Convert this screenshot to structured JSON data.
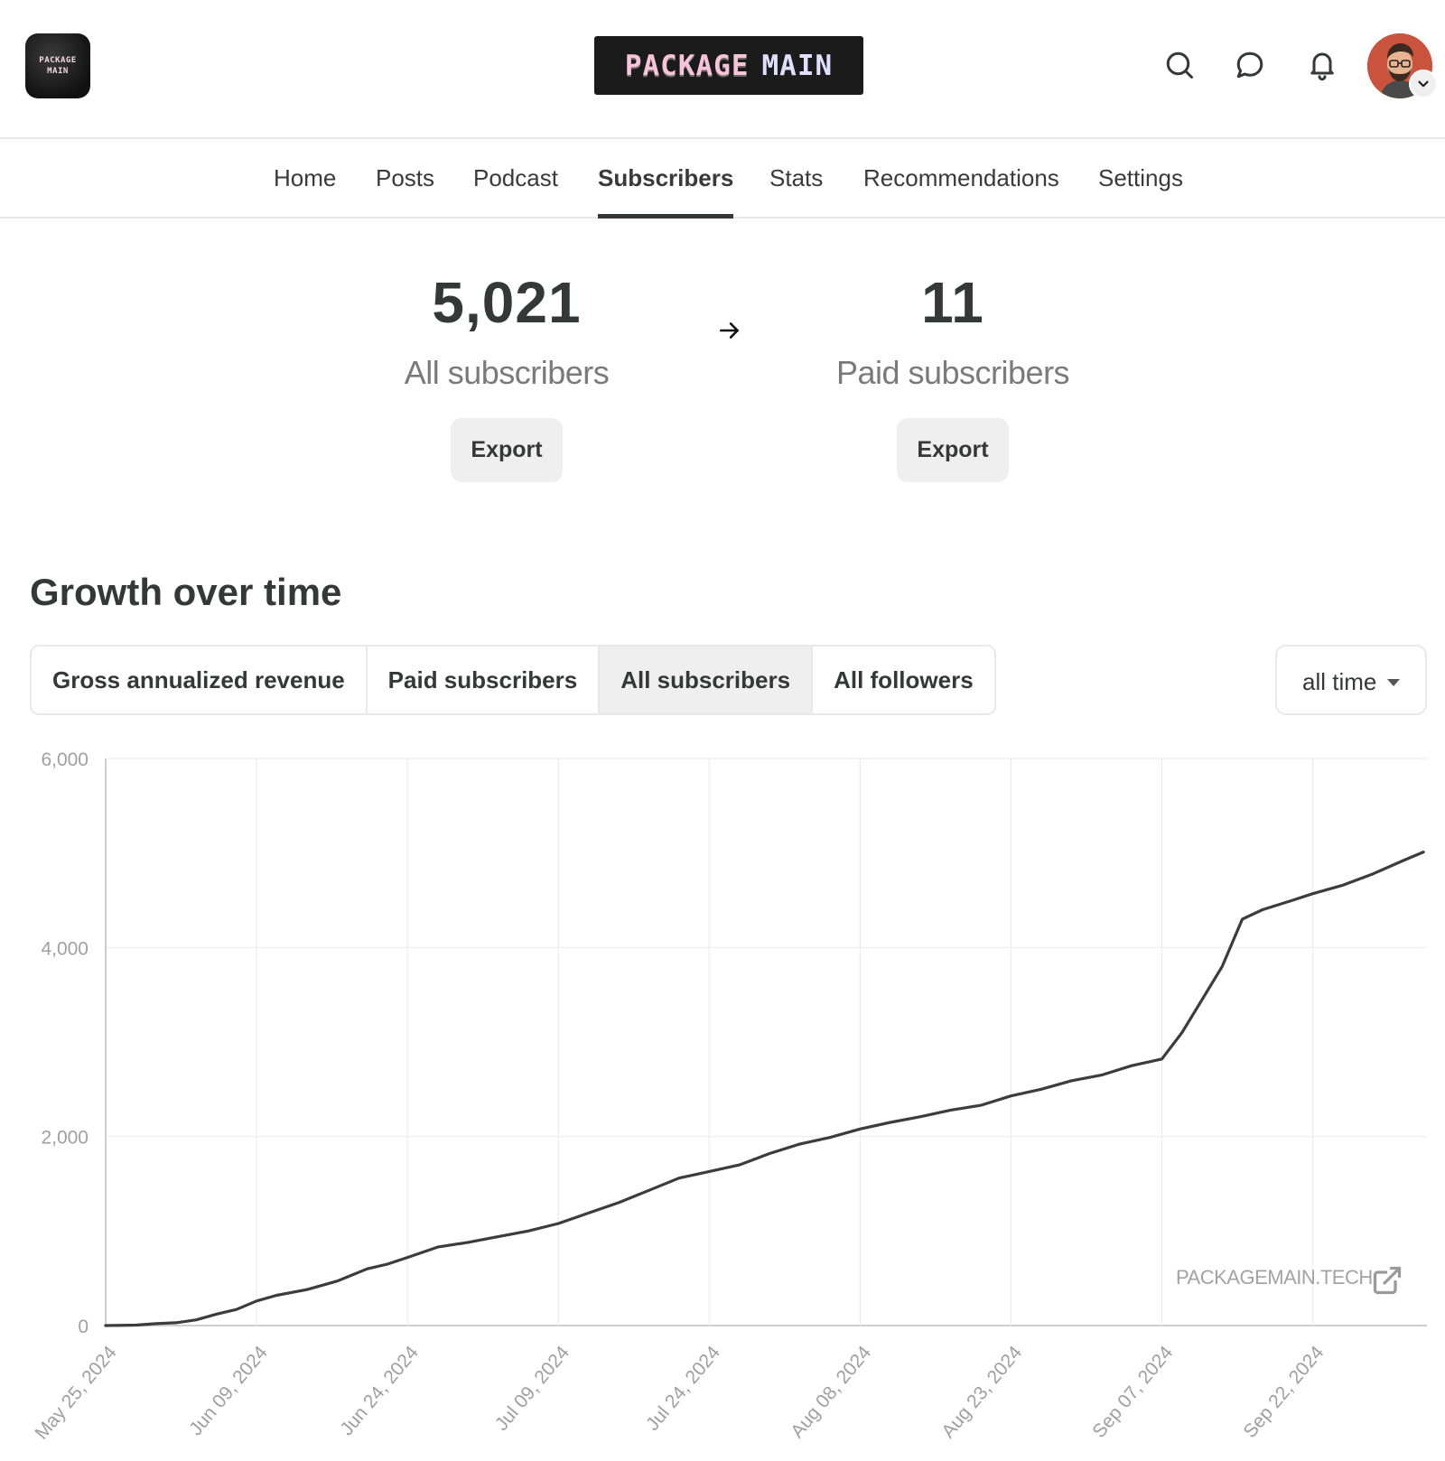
{
  "header": {
    "app_logo_text": [
      "PACKAGE",
      "MAIN"
    ],
    "wordmark": [
      "PACKAGE",
      "MAIN"
    ],
    "icons": [
      "search-icon",
      "chat-icon",
      "bell-icon",
      "avatar",
      "chevron-down-icon"
    ]
  },
  "nav": {
    "tabs": [
      {
        "label": "Home"
      },
      {
        "label": "Posts"
      },
      {
        "label": "Podcast"
      },
      {
        "label": "Subscribers",
        "active": true
      },
      {
        "label": "Stats"
      },
      {
        "label": "Recommendations"
      },
      {
        "label": "Settings"
      }
    ]
  },
  "summary": {
    "all": {
      "value": "5,021",
      "label": "All subscribers",
      "export_label": "Export"
    },
    "paid": {
      "value": "11",
      "label": "Paid subscribers",
      "export_label": "Export"
    }
  },
  "growth": {
    "title": "Growth over time",
    "segments": [
      {
        "label": "Gross annualized revenue"
      },
      {
        "label": "Paid subscribers"
      },
      {
        "label": "All subscribers",
        "active": true
      },
      {
        "label": "All followers"
      }
    ],
    "range": "all time",
    "watermark": "PACKAGEMAIN.TECH"
  },
  "colors": {
    "line": "#3c3c3c",
    "grid": "#ececec",
    "axis": "#cfcfcf",
    "tick": "#a0a0a0"
  },
  "chart_data": {
    "type": "line",
    "title": "",
    "xlabel": "",
    "ylabel": "",
    "ylim": [
      0,
      6000
    ],
    "yticks": [
      "0",
      "2,000",
      "4,000",
      "6,000"
    ],
    "yticks_values": [
      0,
      2000,
      4000,
      6000
    ],
    "xticks": [
      "May 25, 2024",
      "Jun 09, 2024",
      "Jun 24, 2024",
      "Jul 09, 2024",
      "Jul 24, 2024",
      "Aug 08, 2024",
      "Aug 23, 2024",
      "Sep 07, 2024",
      "Sep 22, 2024"
    ],
    "grid": true,
    "series": [
      {
        "x": [
          "2024-05-25",
          "2024-05-28",
          "2024-05-30",
          "2024-06-01",
          "2024-06-03",
          "2024-06-05",
          "2024-06-07",
          "2024-06-09",
          "2024-06-11",
          "2024-06-14",
          "2024-06-17",
          "2024-06-20",
          "2024-06-22",
          "2024-06-24",
          "2024-06-27",
          "2024-06-30",
          "2024-07-03",
          "2024-07-06",
          "2024-07-09",
          "2024-07-12",
          "2024-07-15",
          "2024-07-18",
          "2024-07-21",
          "2024-07-24",
          "2024-07-27",
          "2024-07-30",
          "2024-08-02",
          "2024-08-05",
          "2024-08-08",
          "2024-08-11",
          "2024-08-14",
          "2024-08-17",
          "2024-08-20",
          "2024-08-23",
          "2024-08-26",
          "2024-08-29",
          "2024-09-01",
          "2024-09-04",
          "2024-09-07",
          "2024-09-09",
          "2024-09-11",
          "2024-09-13",
          "2024-09-15",
          "2024-09-17",
          "2024-09-20",
          "2024-09-22",
          "2024-09-25",
          "2024-09-28",
          "2024-10-01",
          "2024-10-03"
        ],
        "y": [
          0,
          5,
          20,
          30,
          60,
          120,
          170,
          260,
          320,
          380,
          470,
          600,
          650,
          720,
          830,
          880,
          940,
          1000,
          1080,
          1190,
          1300,
          1430,
          1560,
          1630,
          1700,
          1820,
          1920,
          1990,
          2080,
          2150,
          2210,
          2280,
          2330,
          2430,
          2500,
          2590,
          2650,
          2750,
          2820,
          3100,
          3450,
          3800,
          4300,
          4400,
          4500,
          4570,
          4660,
          4780,
          4920,
          5010
        ]
      }
    ]
  }
}
